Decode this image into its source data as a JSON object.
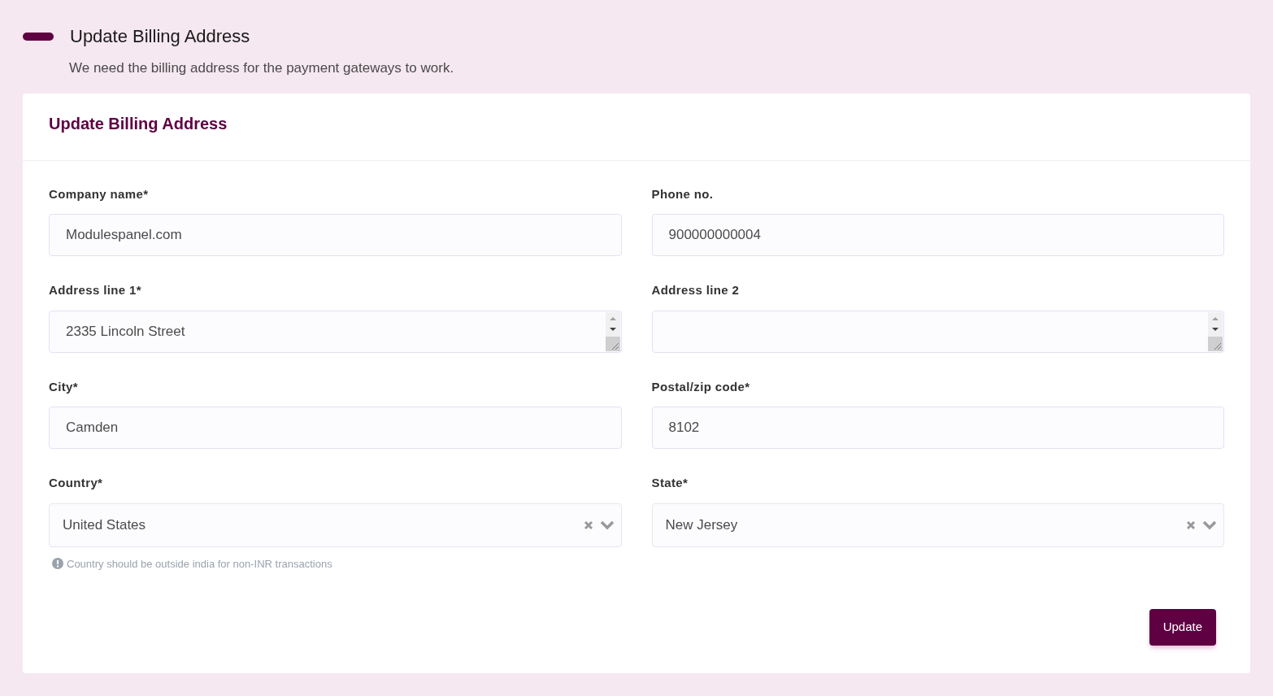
{
  "page": {
    "title": "Update Billing Address",
    "subtitle": "We need the billing address for the payment gateways to work."
  },
  "card": {
    "title": "Update Billing Address"
  },
  "fields": [
    {
      "kind": "text",
      "label": "Company name*",
      "value": "Modulespanel.com"
    },
    {
      "kind": "text",
      "label": "Phone no.",
      "value": "900000000004"
    },
    {
      "kind": "textarea",
      "label": "Address line 1*",
      "value": "2335 Lincoln Street"
    },
    {
      "kind": "textarea",
      "label": "Address line 2"
    },
    {
      "kind": "text",
      "label": "City*",
      "value": "Camden"
    },
    {
      "kind": "text",
      "label": "Postal/zip code*",
      "value": "8102"
    },
    {
      "kind": "select",
      "label": "Country*",
      "value": "United States",
      "hint": "Country should be outside india for non-INR transactions"
    },
    {
      "kind": "select",
      "label": "State*",
      "value": "New Jersey"
    }
  ],
  "button": "Update"
}
